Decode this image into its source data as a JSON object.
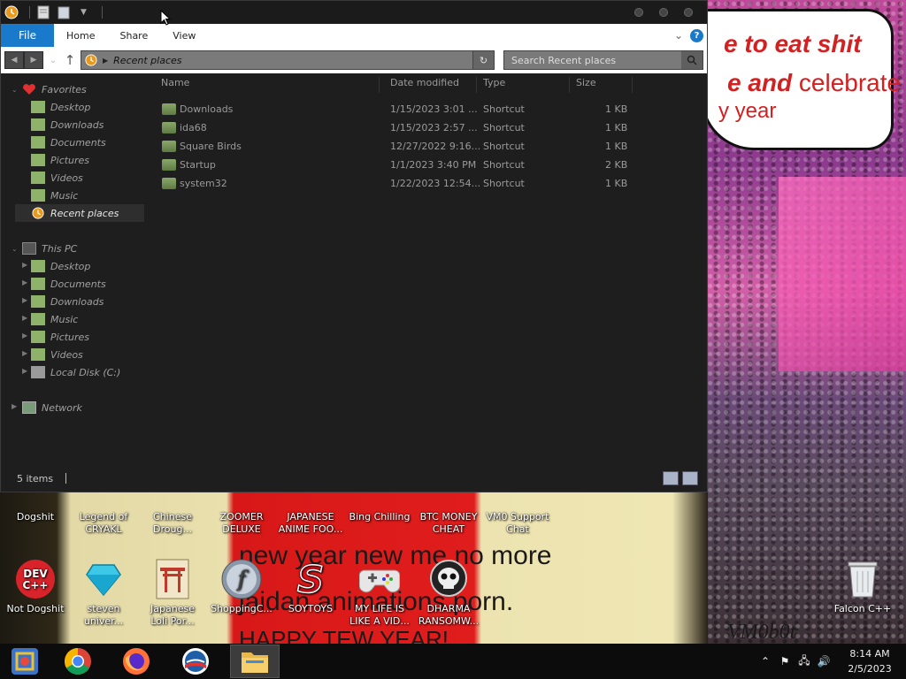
{
  "window": {
    "ribbon_tabs": [
      "File",
      "Home",
      "Share",
      "View"
    ],
    "address": "Recent places",
    "search_placeholder": "Search Recent places"
  },
  "nav": {
    "favorites_label": "Favorites",
    "favorites": [
      "Desktop",
      "Downloads",
      "Documents",
      "Pictures",
      "Videos",
      "Music",
      "Recent places"
    ],
    "this_pc_label": "This PC",
    "this_pc": [
      "Desktop",
      "Documents",
      "Downloads",
      "Music",
      "Pictures",
      "Videos",
      "Local Disk (C:)"
    ],
    "network_label": "Network"
  },
  "columns": {
    "name": "Name",
    "date": "Date modified",
    "type": "Type",
    "size": "Size"
  },
  "files": [
    {
      "name": "Downloads",
      "date": "1/15/2023 3:01 ...",
      "type": "Shortcut",
      "size": "1 KB"
    },
    {
      "name": "ida68",
      "date": "1/15/2023 2:57 ...",
      "type": "Shortcut",
      "size": "1 KB"
    },
    {
      "name": "Square Birds",
      "date": "12/27/2022 9:16...",
      "type": "Shortcut",
      "size": "1 KB"
    },
    {
      "name": "Startup",
      "date": "1/1/2023 3:40 PM",
      "type": "Shortcut",
      "size": "2 KB"
    },
    {
      "name": "system32",
      "date": "1/22/2023 12:54...",
      "type": "Shortcut",
      "size": "1 KB"
    }
  ],
  "status": {
    "count": "5 items"
  },
  "desktop_row1": [
    {
      "label1": "Dogshit",
      "label2": "",
      "icon": "dogshit-icon"
    },
    {
      "label1": "Legend of",
      "label2": "CRYAKL",
      "icon": "legend-icon"
    },
    {
      "label1": "Chinese",
      "label2": "Droug...",
      "icon": "chinese-icon"
    },
    {
      "label1": "ZOOMER",
      "label2": "DELUXE",
      "icon": "zoomer-icon"
    },
    {
      "label1": "JAPANESE",
      "label2": "ANIME FOO...",
      "icon": "anime-icon"
    },
    {
      "label1": "Bing Chilling",
      "label2": "",
      "icon": "bing-icon"
    },
    {
      "label1": "BTC MONEY",
      "label2": "CHEAT",
      "icon": "btc-icon"
    },
    {
      "label1": "VM0 Support",
      "label2": "Chat",
      "icon": "chat-icon"
    }
  ],
  "desktop_row2": [
    {
      "label1": "Not Dogshit",
      "label2": "",
      "icon": "devcpp-icon",
      "devtext": "DEV C++"
    },
    {
      "label1": "steven",
      "label2": "univer...",
      "icon": "diamond-icon"
    },
    {
      "label1": "Japanese",
      "label2": "Loli Por...",
      "icon": "torii-icon"
    },
    {
      "label1": "ShoppingC...",
      "label2": "",
      "icon": "flash-icon"
    },
    {
      "label1": "SOYTOYS",
      "label2": "",
      "icon": "soytoys-icon"
    },
    {
      "label1": "MY LIFE IS",
      "label2": "LIKE A VID...",
      "icon": "gamepad-icon"
    },
    {
      "label1": "DHARMA",
      "label2": "RANSOMW...",
      "icon": "skull-icon"
    }
  ],
  "recycle": {
    "label": "Falcon C++"
  },
  "wallpaper": {
    "bubble_line1": "e to eat shit",
    "bubble_line2a": "e and",
    "bubble_line2b": " celebrate",
    "bubble_line3": "y year",
    "art_line1": "new year new me no more",
    "art_line2": "jaidan animations porn.",
    "art_line3": "HAPPY TEW YEAR!",
    "corner_logo": "VM0b0t"
  },
  "clock": {
    "time": "8:14 AM",
    "date": "2/5/2023"
  },
  "colors": {
    "accent": "#1979ca",
    "window_bg": "#1e1e1e",
    "taskbar": "#0c0c0c"
  }
}
